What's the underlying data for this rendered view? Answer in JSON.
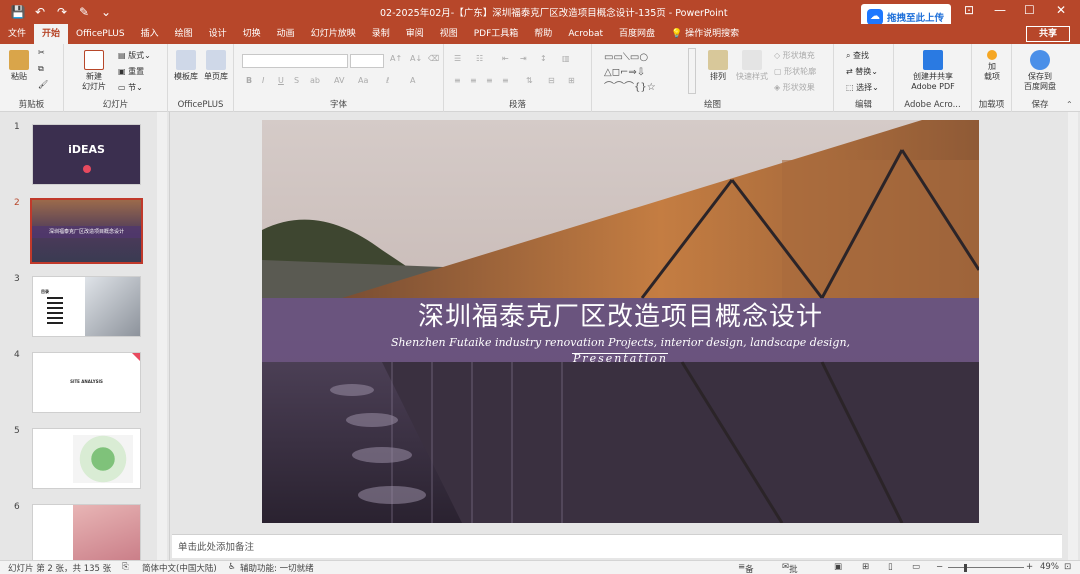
{
  "window": {
    "title": "02-2025年02月-【广东】深圳福泰克厂区改造项目概念设计-135页  -  PowerPoint",
    "upload_label": "拖拽至此上传",
    "share_label": "共享"
  },
  "tabs": [
    {
      "label": "文件"
    },
    {
      "label": "开始"
    },
    {
      "label": "OfficePLUS"
    },
    {
      "label": "插入"
    },
    {
      "label": "绘图"
    },
    {
      "label": "设计"
    },
    {
      "label": "切换"
    },
    {
      "label": "动画"
    },
    {
      "label": "幻灯片放映"
    },
    {
      "label": "录制"
    },
    {
      "label": "审阅"
    },
    {
      "label": "视图"
    },
    {
      "label": "PDF工具箱"
    },
    {
      "label": "帮助"
    },
    {
      "label": "Acrobat"
    },
    {
      "label": "百度网盘"
    },
    {
      "label": "操作说明搜索"
    }
  ],
  "ribbon": {
    "clipboard": {
      "label": "剪贴板",
      "paste": "粘贴"
    },
    "slides": {
      "label": "幻灯片",
      "new_slide": "新建\n幻灯片",
      "layout": "版式",
      "reset": "重置",
      "section": "节"
    },
    "officeplus": {
      "label": "OfficePLUS",
      "template": "模板库",
      "single": "单页库"
    },
    "font": {
      "label": "字体"
    },
    "paragraph": {
      "label": "段落"
    },
    "drawing": {
      "label": "绘图",
      "arrange": "排列",
      "quick_styles": "快速样式",
      "fill": "形状填充",
      "outline": "形状轮廓",
      "effects": "形状效果"
    },
    "editing": {
      "label": "编辑",
      "find": "查找",
      "replace": "替换",
      "select": "选择"
    },
    "acrobat": {
      "label": "Adobe Acro...",
      "create": "创建并共享\nAdobe PDF"
    },
    "addins": {
      "label": "加载项",
      "btn": "加\n载项"
    },
    "save": {
      "label": "保存",
      "btn": "保存到\n百度网盘"
    }
  },
  "thumbnails": [
    {
      "num": "1",
      "title": "iDEAS"
    },
    {
      "num": "2",
      "title": "深圳福泰克厂区改造项目概念设计"
    },
    {
      "num": "3",
      "title": "目录"
    },
    {
      "num": "4",
      "title": "SITE ANALYSIS"
    },
    {
      "num": "5",
      "title": ""
    },
    {
      "num": "6",
      "title": ""
    }
  ],
  "slide": {
    "title": "深圳福泰克厂区改造项目概念设计",
    "subtitle": "Shenzhen Futaike industry renovation Projects, interior design, landscape design,",
    "presentation": "Presentation"
  },
  "notes": {
    "placeholder": "单击此处添加备注"
  },
  "status": {
    "slide_info": "幻灯片 第 2 张，共 135 张",
    "language": "简体中文(中国大陆)",
    "accessibility": "辅助功能: 一切就绪",
    "notes_btn": "备注",
    "comments_btn": "批注",
    "zoom": "49%"
  },
  "colors": {
    "accent": "#b7472a",
    "banner": "#50376e"
  }
}
